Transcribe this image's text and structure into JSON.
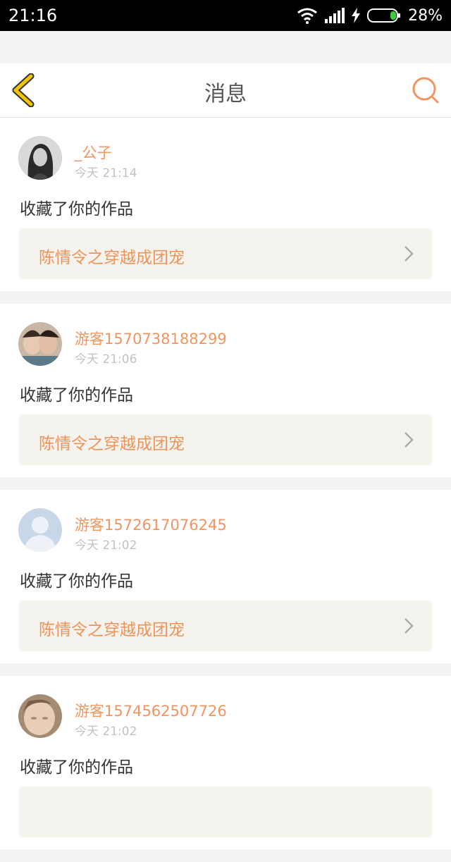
{
  "status": {
    "time": "21:16",
    "battery": "28%"
  },
  "nav": {
    "title": "消息"
  },
  "messages": [
    {
      "user": "_公子",
      "time": "今天 21:14",
      "action": "收藏了你的作品",
      "work": "陈情令之穿越成团宠",
      "avatar": "photo-woman"
    },
    {
      "user": "游客1570738188299",
      "time": "今天 21:06",
      "action": "收藏了你的作品",
      "work": "陈情令之穿越成团宠",
      "avatar": "photo-couple"
    },
    {
      "user": "游客1572617076245",
      "time": "今天 21:02",
      "action": "收藏了你的作品",
      "work": "陈情令之穿越成团宠",
      "avatar": "default-user-icon"
    },
    {
      "user": "游客1574562507726",
      "time": "今天 21:02",
      "action": "收藏了你的作品",
      "work": "",
      "avatar": "photo-baby"
    }
  ],
  "colors": {
    "accent": "#f0955f",
    "back_arrow": "#f2c500"
  }
}
